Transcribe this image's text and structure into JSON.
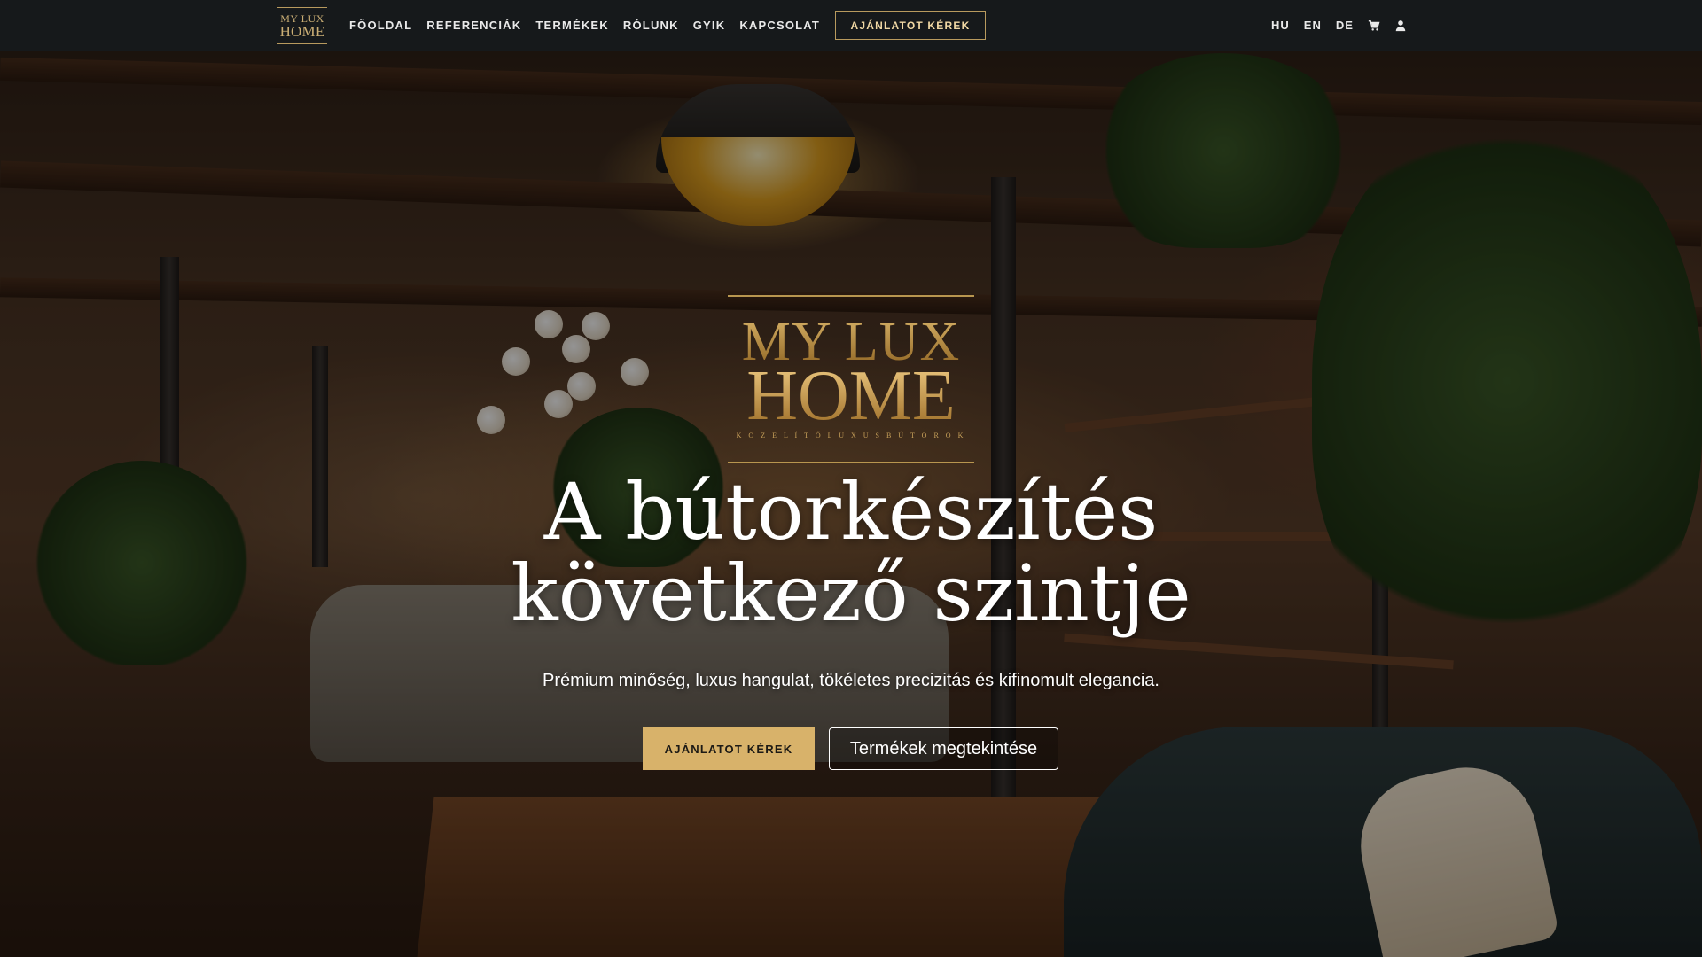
{
  "nav": {
    "logo": {
      "line1": "MY LUX",
      "line2": "HOME"
    },
    "links": [
      "FŐOLDAL",
      "REFERENCIÁK",
      "TERMÉKEK",
      "RÓLUNK",
      "GYIK",
      "KAPCSOLAT"
    ],
    "cta_label": "AJÁNLATOT KÉREK",
    "languages": [
      "HU",
      "EN",
      "DE"
    ],
    "icons": [
      "cart-icon",
      "user-icon"
    ]
  },
  "hero": {
    "logo": {
      "line1": "MY LUX",
      "line2": "HOME",
      "tagline": "K Ö Z E L Í T Ő  L U X U S  B Ú T O R O K"
    },
    "headline_line1": "A bútorkészítés",
    "headline_line2": "következő szintje",
    "subtitle": "Prémium minőség, luxus hangulat, tökéletes precizitás és kifinomult elegancia.",
    "primary_button": "AJÁNLATOT KÉREK",
    "secondary_button": "Termékek megtekintése"
  },
  "colors": {
    "accent_gold": "#d8b26a",
    "navbar_bg": "#16191b",
    "logo_gold": "#c89c4a"
  }
}
